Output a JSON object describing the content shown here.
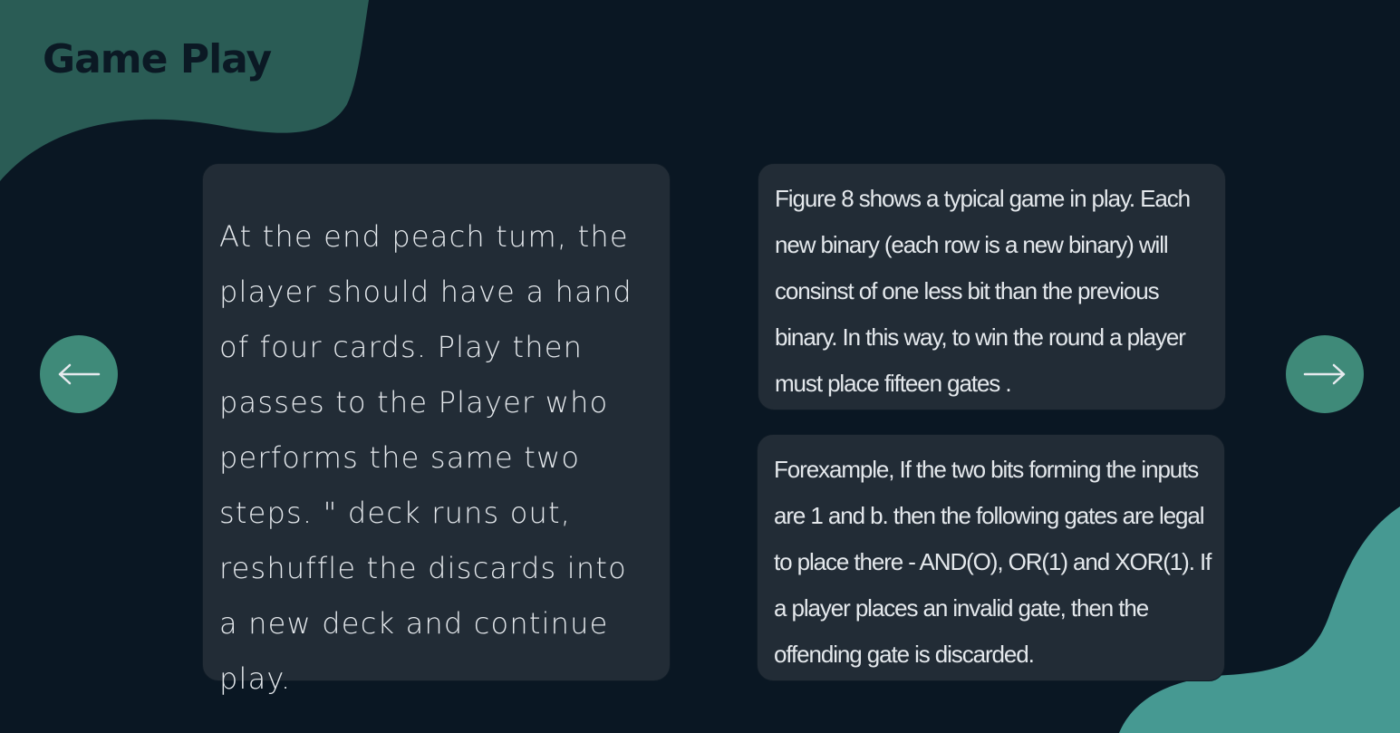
{
  "header": {
    "title": "Game Play"
  },
  "cards": {
    "left": {
      "text": "At the end peach tum, the player should have a hand of four cards. Play then passes to the Player who performs the same two steps. \" deck runs out, reshuffle the discards into a new deck and continue play."
    },
    "right_top": {
      "text": "Figure 8 shows a typical game in play. Each new binary (each row is a new binary) will consinst of one less bit than the previous binary. In this way, to win the round a player must place fifteen gates ."
    },
    "right_bottom": {
      "text": " Forexample, If the two bits forming the inputs are 1 and b. then the following gates are legal to place there - AND(O), OR(1) and XOR(1). If a player places an invalid gate, then the offending gate is discarded."
    }
  },
  "navigation": {
    "prev_icon": "arrow-left-icon",
    "next_icon": "arrow-right-icon"
  },
  "colors": {
    "background": "#0a1723",
    "card": "#222c36",
    "accent": "#3f8a79",
    "blob_top": "#2a5c55",
    "blob_bottom": "#469992",
    "title": "#0b1924",
    "text": "#e4e8ec"
  }
}
